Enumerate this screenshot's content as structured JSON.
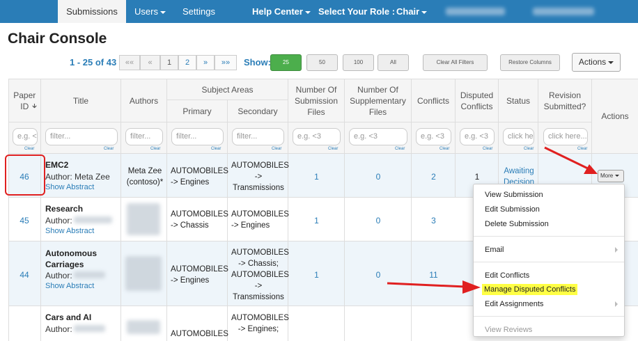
{
  "nav": {
    "submissions": "Submissions",
    "users": "Users",
    "settings": "Settings",
    "help_center": "Help Center",
    "select_role": "Select Your Role :",
    "role": "Chair"
  },
  "page_title": "Chair Console",
  "pager": {
    "range": "1 - 25 of 43",
    "first": "««",
    "prev": "«",
    "page1": "1",
    "page2": "2",
    "next": "»",
    "last": "»»"
  },
  "show": {
    "label": "Show:",
    "options": [
      "25",
      "50",
      "100",
      "All"
    ],
    "selected": "25"
  },
  "toolbar": {
    "clear_filters": "Clear All Filters",
    "restore_columns": "Restore Columns",
    "actions": "Actions"
  },
  "columns": {
    "paper_id": "Paper ID",
    "title": "Title",
    "authors": "Authors",
    "subject_areas": "Subject Areas",
    "primary": "Primary",
    "secondary": "Secondary",
    "num_submission_files": "Number Of Submission Files",
    "num_supplementary_files": "Number Of Supplementary Files",
    "conflicts": "Conflicts",
    "disputed_conflicts": "Disputed Conflicts",
    "status": "Status",
    "revision_submitted": "Revision Submitted?",
    "actions": "Actions"
  },
  "filters": {
    "paper_id": "e.g. <",
    "title": "filter...",
    "authors": "filter...",
    "primary": "filter...",
    "secondary": "filter...",
    "num_submission_files": "e.g. <3",
    "num_supplementary_files": "e.g. <3",
    "conflicts": "e.g. <3",
    "disputed_conflicts": "e.g. <3",
    "status": "click he",
    "revision_submitted": "click here...",
    "clear": "Clear"
  },
  "rows": [
    {
      "id": "46",
      "title": "EMC2",
      "author_label": "Author:",
      "author_name": "Meta Zee",
      "show_abstract": "Show Abstract",
      "authors": "Meta Zee (contoso)*",
      "primary": "AUTOMOBILES -> Engines",
      "secondary": "AUTOMOBILES -> Transmissions",
      "submission_files": "1",
      "supplementary_files": "0",
      "conflicts": "2",
      "disputed": "1",
      "status": "Awaiting Decision",
      "more": "More"
    },
    {
      "id": "45",
      "title": "Research",
      "author_label": "Author:",
      "show_abstract": "Show Abstract",
      "primary": "AUTOMOBILES -> Chassis",
      "secondary": "AUTOMOBILES -> Engines",
      "submission_files": "1",
      "supplementary_files": "0",
      "conflicts": "3"
    },
    {
      "id": "44",
      "title": "Autonomous Carriages",
      "author_label": "Author:",
      "show_abstract": "Show Abstract",
      "primary": "AUTOMOBILES -> Engines",
      "secondary": "AUTOMOBILES -> Chassis; AUTOMOBILES -> Transmissions",
      "submission_files": "1",
      "supplementary_files": "0",
      "conflicts": "11"
    },
    {
      "title": "Cars and AI",
      "author_label": "Author:",
      "primary": "AUTOMOBILES",
      "secondary": "AUTOMOBILES -> Engines;"
    }
  ],
  "menu": {
    "view_submission": "View Submission",
    "edit_submission": "Edit Submission",
    "delete_submission": "Delete Submission",
    "email": "Email",
    "edit_conflicts": "Edit Conflicts",
    "manage_disputed_conflicts": "Manage Disputed Conflicts",
    "edit_assignments": "Edit Assignments",
    "view_reviews": "View Reviews"
  },
  "colors": {
    "nav_bg": "#2a7db7",
    "link": "#2a7db7",
    "highlight": "#ffff44",
    "annotation_red": "#e02020",
    "show_selected": "#4cae4c"
  }
}
